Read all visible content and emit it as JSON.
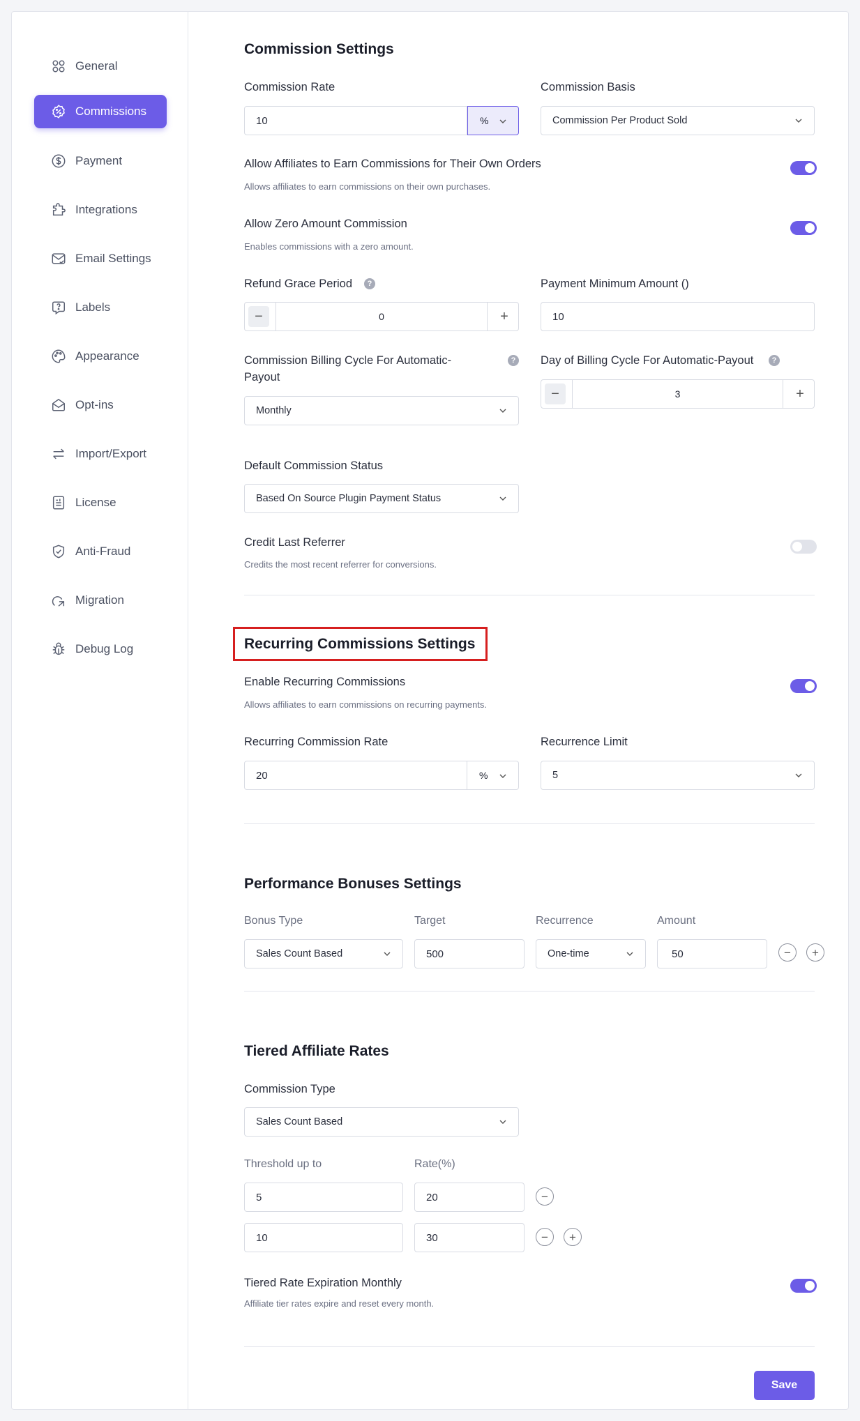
{
  "sidebar": {
    "items": [
      {
        "label": "General",
        "icon": "grid-icon"
      },
      {
        "label": "Commissions",
        "icon": "badge-percent-icon",
        "active": true
      },
      {
        "label": "Payment",
        "icon": "dollar-circle-icon"
      },
      {
        "label": "Integrations",
        "icon": "puzzle-icon"
      },
      {
        "label": "Email Settings",
        "icon": "mail-check-icon"
      },
      {
        "label": "Labels",
        "icon": "help-bubble-icon"
      },
      {
        "label": "Appearance",
        "icon": "palette-icon"
      },
      {
        "label": "Opt-ins",
        "icon": "envelope-open-icon"
      },
      {
        "label": "Import/Export",
        "icon": "arrows-swap-icon"
      },
      {
        "label": "License",
        "icon": "license-icon"
      },
      {
        "label": "Anti-Fraud",
        "icon": "shield-check-icon"
      },
      {
        "label": "Migration",
        "icon": "migration-icon"
      },
      {
        "label": "Debug Log",
        "icon": "bug-icon"
      }
    ],
    "accent_color": "#6c5ce7"
  },
  "commission": {
    "title": "Commission Settings",
    "rate_label": "Commission Rate",
    "rate_value": "10",
    "rate_unit": "%",
    "basis_label": "Commission Basis",
    "basis_value": "Commission Per Product Sold",
    "own_orders_label": "Allow Affiliates to Earn Commissions for Their Own Orders",
    "own_orders_desc": "Allows affiliates to earn commissions on their own purchases.",
    "own_orders_on": true,
    "zero_label": "Allow Zero Amount Commission",
    "zero_desc": "Enables commissions with a zero amount.",
    "zero_on": true,
    "refund_label": "Refund Grace Period",
    "refund_value": "0",
    "payment_min_label": "Payment Minimum Amount ()",
    "payment_min_value": "10",
    "billing_cycle_label_1": "Commission Billing Cycle For Automatic-",
    "billing_cycle_label_2": "Payout",
    "billing_cycle_value": "Monthly",
    "billing_day_label": "Day of Billing Cycle For Automatic-Payout",
    "billing_day_value": "3",
    "default_status_label": "Default Commission Status",
    "default_status_value": "Based On Source Plugin Payment Status",
    "credit_last_label": "Credit Last Referrer",
    "credit_last_desc": "Credits the most recent referrer for conversions.",
    "credit_last_on": false
  },
  "recurring": {
    "title": "Recurring Commissions Settings",
    "enable_label": "Enable Recurring Commissions",
    "enable_desc": "Allows affiliates to earn commissions on recurring payments.",
    "enable_on": true,
    "rate_label": "Recurring Commission Rate",
    "rate_value": "20",
    "rate_unit": "%",
    "limit_label": "Recurrence Limit",
    "limit_value": "5"
  },
  "bonuses": {
    "title": "Performance Bonuses Settings",
    "col_type": "Bonus Type",
    "col_target": "Target",
    "col_recurrence": "Recurrence",
    "col_amount": "Amount",
    "row": {
      "type": "Sales Count Based",
      "target": "500",
      "recurrence": "One-time",
      "amount": "50"
    }
  },
  "tiered": {
    "title": "Tiered Affiliate Rates",
    "type_label": "Commission Type",
    "type_value": "Sales Count Based",
    "col_threshold": "Threshold up to",
    "col_rate": "Rate(%)",
    "rows": [
      {
        "threshold": "5",
        "rate": "20"
      },
      {
        "threshold": "10",
        "rate": "30"
      }
    ],
    "expire_label": "Tiered Rate Expiration Monthly",
    "expire_desc": "Affiliate tier rates expire and reset every month.",
    "expire_on": true
  },
  "actions": {
    "save_label": "Save"
  }
}
